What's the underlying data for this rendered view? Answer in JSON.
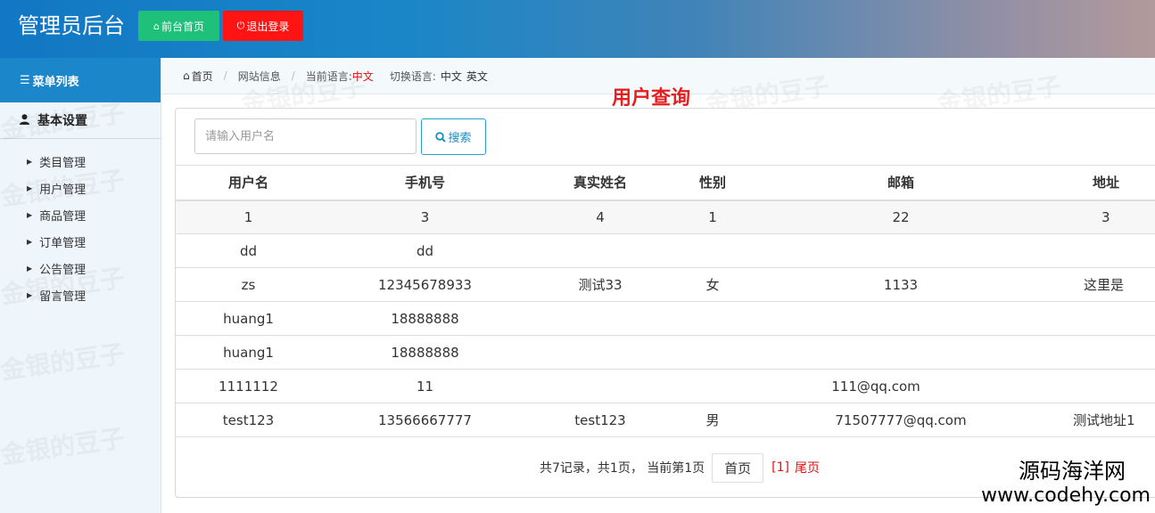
{
  "header": {
    "title": "管理员后台",
    "home_button": "前台首页",
    "logout_button": "退出登录"
  },
  "sidebar": {
    "menu_title": "菜单列表",
    "group_title": "基本设置",
    "items": [
      {
        "label": "类目管理"
      },
      {
        "label": "用户管理"
      },
      {
        "label": "商品管理"
      },
      {
        "label": "订单管理"
      },
      {
        "label": "公告管理"
      },
      {
        "label": "留言管理"
      }
    ]
  },
  "breadcrumb": {
    "home": "首页",
    "site_info": "网站信息",
    "current_lang_label": "当前语言:",
    "current_lang_value": "中文",
    "switch_lang_label": "切换语言:",
    "lang_zh": "中文",
    "lang_en": "英文"
  },
  "watermark": "金银的豆子",
  "page_heading": "用户查询",
  "search": {
    "placeholder": "请输入用户名",
    "value": "",
    "button": "搜索"
  },
  "table": {
    "columns": [
      "用户名",
      "手机号",
      "真实姓名",
      "性别",
      "邮箱",
      "地址"
    ],
    "rows": [
      [
        "1",
        "3",
        "4",
        "1",
        "22",
        "3"
      ],
      [
        "dd",
        "dd",
        "",
        "",
        "",
        ""
      ],
      [
        "zs",
        "12345678933",
        "测试33",
        "女",
        "1133",
        "这里是"
      ],
      [
        "huang1",
        "18888888",
        "",
        "",
        "",
        ""
      ],
      [
        "huang1",
        "18888888",
        "",
        "",
        "",
        ""
      ],
      [
        "1111112",
        "11",
        "",
        "",
        "111@qq.com",
        ""
      ],
      [
        "test123",
        "13566667777",
        "test123",
        "男",
        "71507777@qq.com",
        "测试地址1"
      ]
    ]
  },
  "pager": {
    "summary": "共7记录，共1页， 当前第1页",
    "first": "首页",
    "current": "[1]",
    "last": "尾页"
  },
  "corner": {
    "line1": "源码海洋网",
    "line2": "www.codehy.com"
  },
  "colors": {
    "accent": "#1b86c9",
    "home_button": "#1ec07a",
    "logout_button": "#ff1414",
    "highlight": "#e31010"
  }
}
